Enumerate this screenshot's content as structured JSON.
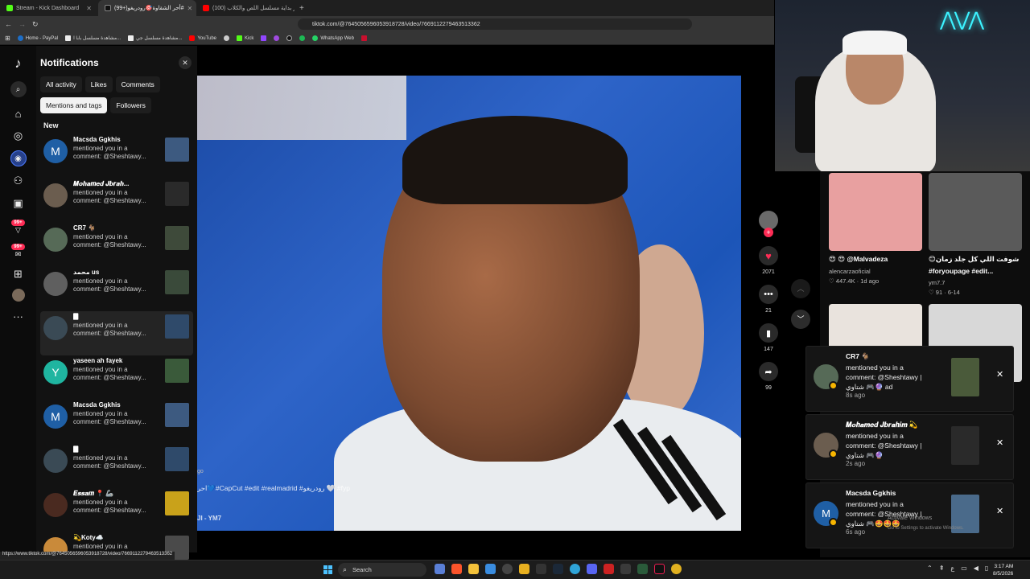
{
  "browser": {
    "tabs": [
      {
        "label": "Stream - Kick Dashboard",
        "color": "#53fc18"
      },
      {
        "label": "(99+)أحر الشقاوة🎯رودريغو#",
        "color": "#ffffff"
      },
      {
        "label": "(100) اثر بداية مسلسل اللص والكلاب ...",
        "color": "#ff0000"
      }
    ],
    "url": "tiktok.com/@7645056596053918728/video/7669112279463513362",
    "bookmarks": [
      "Home - PayPal",
      "مشاهدة مسلسل بابا ا...",
      "مشاهدة مسلسل جي...",
      "YouTube",
      "Kick",
      "WhatsApp Web"
    ]
  },
  "rail": {
    "badge1": "99+",
    "badge2": "99+"
  },
  "notifications": {
    "title": "Notifications",
    "filters": [
      "All activity",
      "Likes",
      "Comments",
      "Mentions and tags",
      "Followers"
    ],
    "selected_filter": "Mentions and tags",
    "section": "New",
    "items": [
      {
        "name": "Macsda Ggkhis",
        "message": "mentioned you in a comment: @Sheshtawy...",
        "avatar": "M",
        "avatar_color": "#1f5fa5",
        "thumb_color": "#3d5a80"
      },
      {
        "name": "𝑴𝒐𝒉𝒂𝒎𝒆𝒅 𝑱𝒃𝒓𝒂𝒉...",
        "message": "mentioned you in a comment: @Sheshtawy...",
        "avatar": "",
        "avatar_color": "#6b5d4f",
        "thumb_color": "#2a2a2a"
      },
      {
        "name": "CR7 🐐",
        "message": "mentioned you in a comment: @Sheshtawy...",
        "avatar": "",
        "avatar_color": "#566a57",
        "thumb_color": "#3e4a3a"
      },
      {
        "name": "محمد us",
        "message": "mentioned you in a comment: @Sheshtawy...",
        "avatar": "",
        "avatar_color": "#5f5f5f",
        "thumb_color": "#3a4a3a"
      },
      {
        "name": "🀫",
        "message": "mentioned you in a comment: @Sheshtawy...",
        "avatar": "",
        "avatar_color": "#3a4a55",
        "thumb_color": "#2f4a6a"
      },
      {
        "name": "yaseen ah fayek",
        "message": "mentioned you in a comment: @Sheshtawy...",
        "avatar": "Y",
        "avatar_color": "#1fb5a0",
        "thumb_color": "#3a5a3a"
      },
      {
        "name": "Macsda Ggkhis",
        "message": "mentioned you in a comment: @Sheshtawy...",
        "avatar": "M",
        "avatar_color": "#1f5fa5",
        "thumb_color": "#3d5a80"
      },
      {
        "name": "🀫",
        "message": "mentioned you in a comment: @Sheshtawy...",
        "avatar": "",
        "avatar_color": "#3a4a55",
        "thumb_color": "#2f4a6a"
      },
      {
        "name": "𝑬𝒔𝒔𝒂𝒎 📍 🦾",
        "message": "mentioned you in a comment: @Sheshtawy...",
        "avatar": "",
        "avatar_color": "#4a2a20",
        "thumb_color": "#c9a21a"
      },
      {
        "name": "💫Koty☁️",
        "message": "mentioned you in a",
        "avatar": "",
        "avatar_color": "#c98a3a",
        "thumb_color": "#4a4a4a"
      }
    ]
  },
  "video": {
    "ago": "go",
    "caption": "احر💙#CapCut #edit #realmadrid #رودريغو 🤍 #fyp",
    "music": "JI - YM7",
    "progress": 0.17,
    "likes": "2071",
    "comments": "21",
    "saves": "147",
    "shares": "99"
  },
  "grid": [
    {
      "title": "😍 😍 @Malvadeza",
      "user": "alencarzaoficial",
      "stats": "♡ 447.4K · 1d ago",
      "color": "#e8a0a0"
    },
    {
      "title": "😊شوفت اللي كل جلد زمان",
      "user": "#foryoupage #edit...",
      "stats": "ym7.7",
      "color": "#5a5a5a"
    },
    {
      "title": "",
      "user": "",
      "stats": "♡ 91 · 6-14",
      "color": "#e9e3dd"
    },
    {
      "title": "",
      "user": "",
      "stats": "",
      "color": "#d8d8d8"
    }
  ],
  "toasts": [
    {
      "name": "CR7 🐐",
      "message": "mentioned you in a comment: @Sheshtawy | شتاوي 🎮🔮 ad",
      "time": "8s ago",
      "avatar": "",
      "avatar_color": "#566a57",
      "thumb_color": "#4a5a3a"
    },
    {
      "name": "𝑴𝒐𝒉𝒂𝒎𝒆𝒅 𝑱𝒃𝒓𝒂𝒉𝒊𝒎 💫",
      "message": "mentioned you in a comment: @Sheshtawy | شتاوي 🎮🔮",
      "time": "2s ago",
      "avatar": "",
      "avatar_color": "#6b5d4f",
      "thumb_color": "#2a2a2a"
    },
    {
      "name": "Macsda Ggkhis",
      "message": "mentioned you in a comment: @Sheshtawy | شتاوي 🎮🤩🤩🤩",
      "time": "6s ago",
      "avatar": "M",
      "avatar_color": "#1f5fa5",
      "thumb_color": "#4a6a8a"
    }
  ],
  "watermark": {
    "line1": "Activate Windows",
    "line2": "Go to Settings to activate Windows."
  },
  "status_url": "https://www.tiktok.com/@7645056596053918728/video/7669112279463513362",
  "taskbar": {
    "search": "Search",
    "time": "3:17 AM",
    "date": "8/5/2026"
  }
}
